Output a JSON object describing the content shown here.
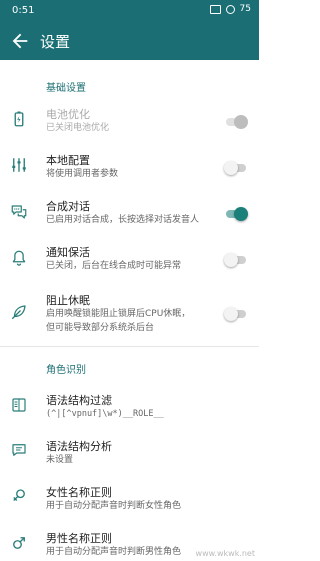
{
  "status": {
    "time": "0:51",
    "battery": "75"
  },
  "appbar": {
    "title": "设置"
  },
  "sections": [
    {
      "header": "基础设置"
    },
    {
      "header": "角色识别"
    }
  ],
  "rows": [
    {
      "title": "电池优化",
      "summary": "已关闭电池优化",
      "switch": "disabled-on"
    },
    {
      "title": "本地配置",
      "summary": "将使用调用者参数",
      "switch": "off"
    },
    {
      "title": "合成对话",
      "summary": "已启用对话合成，长按选择对话发音人",
      "switch": "on"
    },
    {
      "title": "通知保活",
      "summary": "已关闭，后台在线合成时可能异常",
      "switch": "off"
    },
    {
      "title": "阻止休眠",
      "summary_lines": [
        "启用唤醒锁能阻止锁屏后CPU休眠，",
        "但可能导致部分系统杀后台"
      ],
      "switch": "off"
    },
    {
      "title": "语法结构过滤",
      "summary": "(^|[^vpnuf]\\w*)__ROLE__"
    },
    {
      "title": "语法结构分析",
      "summary": "未设置"
    },
    {
      "title": "女性名称正则",
      "summary": "用于自动分配声音时判断女性角色"
    },
    {
      "title": "男性名称正则",
      "summary": "用于自动分配声音时判断男性角色"
    }
  ],
  "watermark": "www.wkwk.net",
  "colors": {
    "primary": "#1b6f74",
    "accent": "#1b7f7a"
  }
}
